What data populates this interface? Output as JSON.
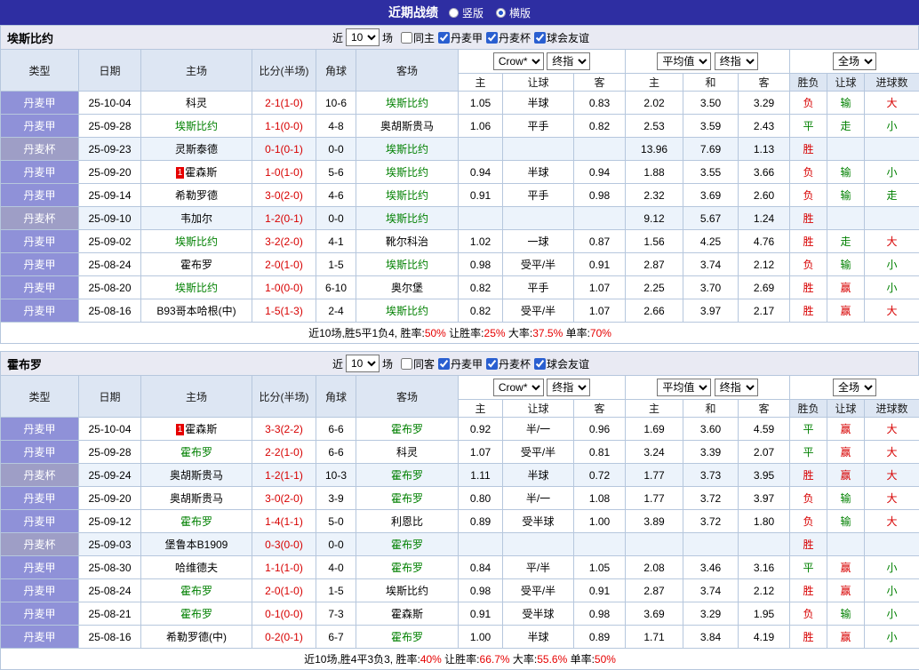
{
  "topbar": {
    "title": "近期战绩",
    "radios": [
      {
        "label": "竖版",
        "checked": false
      },
      {
        "label": "横版",
        "checked": true
      }
    ]
  },
  "colors": {
    "topbar_bg": "#2e2ea2",
    "header_bg": "#dde6f3",
    "type_league_bg": "#8f91d8",
    "type_cup_bg": "#9e9ec6",
    "focal_team_green": "#008000",
    "score_red": "#d70000",
    "summary_value_red": "#e60000"
  },
  "sections": [
    {
      "team": "埃斯比约",
      "filter": {
        "near_label": "近",
        "count": "10",
        "games_label": "场",
        "same_venue": {
          "label": "同主",
          "checked": false
        },
        "leagues": [
          {
            "label": "丹麦甲",
            "checked": true
          },
          {
            "label": "丹麦杯",
            "checked": true
          },
          {
            "label": "球会友谊",
            "checked": true
          }
        ]
      },
      "header": {
        "cols": [
          "类型",
          "日期",
          "主场",
          "比分(半场)",
          "角球",
          "客场"
        ],
        "odds1_selects": [
          "Crow*",
          "终指"
        ],
        "odds1_cols": [
          "主",
          "让球",
          "客"
        ],
        "odds2_selects": [
          "平均值",
          "终指"
        ],
        "odds2_cols": [
          "主",
          "和",
          "客"
        ],
        "result_select": "全场",
        "result_cols": [
          "胜负",
          "让球",
          "进球数"
        ]
      },
      "rows": [
        {
          "type": "丹麦甲",
          "cup": false,
          "date": "25-10-04",
          "home": "科灵",
          "home_focal": false,
          "home_badge": "",
          "score": "2-1(1-0)",
          "corner": "10-6",
          "away": "埃斯比约",
          "away_focal": true,
          "away_badge": "",
          "crow": [
            "1.05",
            "半球",
            "0.83"
          ],
          "avg": [
            "2.02",
            "3.50",
            "3.29"
          ],
          "results": [
            [
              "负",
              "red"
            ],
            [
              "输",
              "green"
            ],
            [
              "大",
              "red"
            ]
          ]
        },
        {
          "type": "丹麦甲",
          "cup": false,
          "date": "25-09-28",
          "home": "埃斯比约",
          "home_focal": true,
          "home_badge": "",
          "score": "1-1(0-0)",
          "corner": "4-8",
          "away": "奥胡斯贵马",
          "away_focal": false,
          "away_badge": "",
          "crow": [
            "1.06",
            "平手",
            "0.82"
          ],
          "avg": [
            "2.53",
            "3.59",
            "2.43"
          ],
          "results": [
            [
              "平",
              "green"
            ],
            [
              "走",
              "green"
            ],
            [
              "小",
              "green"
            ]
          ]
        },
        {
          "type": "丹麦杯",
          "cup": true,
          "date": "25-09-23",
          "home": "灵斯泰德",
          "home_focal": false,
          "home_badge": "",
          "score": "0-1(0-1)",
          "corner": "0-0",
          "away": "埃斯比约",
          "away_focal": true,
          "away_badge": "",
          "crow": [
            "",
            "",
            ""
          ],
          "avg": [
            "13.96",
            "7.69",
            "1.13"
          ],
          "results": [
            [
              "胜",
              "red"
            ],
            [
              "",
              ""
            ],
            [
              "",
              ""
            ]
          ]
        },
        {
          "type": "丹麦甲",
          "cup": false,
          "date": "25-09-20",
          "home": "霍森斯",
          "home_focal": false,
          "home_badge": "1",
          "score": "1-0(1-0)",
          "corner": "5-6",
          "away": "埃斯比约",
          "away_focal": true,
          "away_badge": "",
          "crow": [
            "0.94",
            "半球",
            "0.94"
          ],
          "avg": [
            "1.88",
            "3.55",
            "3.66"
          ],
          "results": [
            [
              "负",
              "red"
            ],
            [
              "输",
              "green"
            ],
            [
              "小",
              "green"
            ]
          ]
        },
        {
          "type": "丹麦甲",
          "cup": false,
          "date": "25-09-14",
          "home": "希勒罗德",
          "home_focal": false,
          "home_badge": "",
          "score": "3-0(2-0)",
          "corner": "4-6",
          "away": "埃斯比约",
          "away_focal": true,
          "away_badge": "",
          "crow": [
            "0.91",
            "平手",
            "0.98"
          ],
          "avg": [
            "2.32",
            "3.69",
            "2.60"
          ],
          "results": [
            [
              "负",
              "red"
            ],
            [
              "输",
              "green"
            ],
            [
              "走",
              "green"
            ]
          ]
        },
        {
          "type": "丹麦杯",
          "cup": true,
          "date": "25-09-10",
          "home": "韦加尔",
          "home_focal": false,
          "home_badge": "",
          "score": "1-2(0-1)",
          "corner": "0-0",
          "away": "埃斯比约",
          "away_focal": true,
          "away_badge": "",
          "crow": [
            "",
            "",
            ""
          ],
          "avg": [
            "9.12",
            "5.67",
            "1.24"
          ],
          "results": [
            [
              "胜",
              "red"
            ],
            [
              "",
              ""
            ],
            [
              "",
              ""
            ]
          ]
        },
        {
          "type": "丹麦甲",
          "cup": false,
          "date": "25-09-02",
          "home": "埃斯比约",
          "home_focal": true,
          "home_badge": "",
          "score": "3-2(2-0)",
          "corner": "4-1",
          "away": "靴尔科治",
          "away_focal": false,
          "away_badge": "",
          "crow": [
            "1.02",
            "一球",
            "0.87"
          ],
          "avg": [
            "1.56",
            "4.25",
            "4.76"
          ],
          "results": [
            [
              "胜",
              "red"
            ],
            [
              "走",
              "green"
            ],
            [
              "大",
              "red"
            ]
          ]
        },
        {
          "type": "丹麦甲",
          "cup": false,
          "date": "25-08-24",
          "home": "霍布罗",
          "home_focal": false,
          "home_badge": "",
          "score": "2-0(1-0)",
          "corner": "1-5",
          "away": "埃斯比约",
          "away_focal": true,
          "away_badge": "",
          "crow": [
            "0.98",
            "受平/半",
            "0.91"
          ],
          "avg": [
            "2.87",
            "3.74",
            "2.12"
          ],
          "results": [
            [
              "负",
              "red"
            ],
            [
              "输",
              "green"
            ],
            [
              "小",
              "green"
            ]
          ]
        },
        {
          "type": "丹麦甲",
          "cup": false,
          "date": "25-08-20",
          "home": "埃斯比约",
          "home_focal": true,
          "home_badge": "",
          "score": "1-0(0-0)",
          "corner": "6-10",
          "away": "奥尔堡",
          "away_focal": false,
          "away_badge": "",
          "crow": [
            "0.82",
            "平手",
            "1.07"
          ],
          "avg": [
            "2.25",
            "3.70",
            "2.69"
          ],
          "results": [
            [
              "胜",
              "red"
            ],
            [
              "赢",
              "red"
            ],
            [
              "小",
              "green"
            ]
          ]
        },
        {
          "type": "丹麦甲",
          "cup": false,
          "date": "25-08-16",
          "home": "B93哥本哈根(中)",
          "home_focal": false,
          "home_badge": "",
          "score": "1-5(1-3)",
          "corner": "2-4",
          "away": "埃斯比约",
          "away_focal": true,
          "away_badge": "",
          "crow": [
            "0.82",
            "受平/半",
            "1.07"
          ],
          "avg": [
            "2.66",
            "3.97",
            "2.17"
          ],
          "results": [
            [
              "胜",
              "red"
            ],
            [
              "赢",
              "red"
            ],
            [
              "大",
              "red"
            ]
          ]
        }
      ],
      "summary": [
        [
          "近10场,胜5平1负4, 胜率:",
          "k"
        ],
        [
          "50%",
          "v"
        ],
        [
          " 让胜率:",
          "k"
        ],
        [
          "25%",
          "v"
        ],
        [
          " 大率:",
          "k"
        ],
        [
          "37.5%",
          "v"
        ],
        [
          " 单率:",
          "k"
        ],
        [
          "70%",
          "v"
        ]
      ]
    },
    {
      "team": "霍布罗",
      "filter": {
        "near_label": "近",
        "count": "10",
        "games_label": "场",
        "same_venue": {
          "label": "同客",
          "checked": false
        },
        "leagues": [
          {
            "label": "丹麦甲",
            "checked": true
          },
          {
            "label": "丹麦杯",
            "checked": true
          },
          {
            "label": "球会友谊",
            "checked": true
          }
        ]
      },
      "header": {
        "cols": [
          "类型",
          "日期",
          "主场",
          "比分(半场)",
          "角球",
          "客场"
        ],
        "odds1_selects": [
          "Crow*",
          "终指"
        ],
        "odds1_cols": [
          "主",
          "让球",
          "客"
        ],
        "odds2_selects": [
          "平均值",
          "终指"
        ],
        "odds2_cols": [
          "主",
          "和",
          "客"
        ],
        "result_select": "全场",
        "result_cols": [
          "胜负",
          "让球",
          "进球数"
        ]
      },
      "rows": [
        {
          "type": "丹麦甲",
          "cup": false,
          "date": "25-10-04",
          "home": "霍森斯",
          "home_focal": false,
          "home_badge": "1",
          "score": "3-3(2-2)",
          "corner": "6-6",
          "away": "霍布罗",
          "away_focal": true,
          "away_badge": "",
          "crow": [
            "0.92",
            "半/一",
            "0.96"
          ],
          "avg": [
            "1.69",
            "3.60",
            "4.59"
          ],
          "results": [
            [
              "平",
              "green"
            ],
            [
              "赢",
              "red"
            ],
            [
              "大",
              "red"
            ]
          ]
        },
        {
          "type": "丹麦甲",
          "cup": false,
          "date": "25-09-28",
          "home": "霍布罗",
          "home_focal": true,
          "home_badge": "",
          "score": "2-2(1-0)",
          "corner": "6-6",
          "away": "科灵",
          "away_focal": false,
          "away_badge": "",
          "crow": [
            "1.07",
            "受平/半",
            "0.81"
          ],
          "avg": [
            "3.24",
            "3.39",
            "2.07"
          ],
          "results": [
            [
              "平",
              "green"
            ],
            [
              "赢",
              "red"
            ],
            [
              "大",
              "red"
            ]
          ]
        },
        {
          "type": "丹麦杯",
          "cup": true,
          "date": "25-09-24",
          "home": "奥胡斯贵马",
          "home_focal": false,
          "home_badge": "",
          "score": "1-2(1-1)",
          "corner": "10-3",
          "away": "霍布罗",
          "away_focal": true,
          "away_badge": "",
          "crow": [
            "1.11",
            "半球",
            "0.72"
          ],
          "avg": [
            "1.77",
            "3.73",
            "3.95"
          ],
          "results": [
            [
              "胜",
              "red"
            ],
            [
              "赢",
              "red"
            ],
            [
              "大",
              "red"
            ]
          ]
        },
        {
          "type": "丹麦甲",
          "cup": false,
          "date": "25-09-20",
          "home": "奥胡斯贵马",
          "home_focal": false,
          "home_badge": "",
          "score": "3-0(2-0)",
          "corner": "3-9",
          "away": "霍布罗",
          "away_focal": true,
          "away_badge": "",
          "crow": [
            "0.80",
            "半/一",
            "1.08"
          ],
          "avg": [
            "1.77",
            "3.72",
            "3.97"
          ],
          "results": [
            [
              "负",
              "red"
            ],
            [
              "输",
              "green"
            ],
            [
              "大",
              "red"
            ]
          ]
        },
        {
          "type": "丹麦甲",
          "cup": false,
          "date": "25-09-12",
          "home": "霍布罗",
          "home_focal": true,
          "home_badge": "",
          "score": "1-4(1-1)",
          "corner": "5-0",
          "away": "利恩比",
          "away_focal": false,
          "away_badge": "",
          "crow": [
            "0.89",
            "受半球",
            "1.00"
          ],
          "avg": [
            "3.89",
            "3.72",
            "1.80"
          ],
          "results": [
            [
              "负",
              "red"
            ],
            [
              "输",
              "green"
            ],
            [
              "大",
              "red"
            ]
          ]
        },
        {
          "type": "丹麦杯",
          "cup": true,
          "date": "25-09-03",
          "home": "堡鲁本B1909",
          "home_focal": false,
          "home_badge": "",
          "score": "0-3(0-0)",
          "corner": "0-0",
          "away": "霍布罗",
          "away_focal": true,
          "away_badge": "",
          "crow": [
            "",
            "",
            ""
          ],
          "avg": [
            "",
            "",
            ""
          ],
          "results": [
            [
              "胜",
              "red"
            ],
            [
              "",
              ""
            ],
            [
              "",
              ""
            ]
          ]
        },
        {
          "type": "丹麦甲",
          "cup": false,
          "date": "25-08-30",
          "home": "哈维德夫",
          "home_focal": false,
          "home_badge": "",
          "score": "1-1(1-0)",
          "corner": "4-0",
          "away": "霍布罗",
          "away_focal": true,
          "away_badge": "",
          "crow": [
            "0.84",
            "平/半",
            "1.05"
          ],
          "avg": [
            "2.08",
            "3.46",
            "3.16"
          ],
          "results": [
            [
              "平",
              "green"
            ],
            [
              "赢",
              "red"
            ],
            [
              "小",
              "green"
            ]
          ]
        },
        {
          "type": "丹麦甲",
          "cup": false,
          "date": "25-08-24",
          "home": "霍布罗",
          "home_focal": true,
          "home_badge": "",
          "score": "2-0(1-0)",
          "corner": "1-5",
          "away": "埃斯比约",
          "away_focal": false,
          "away_badge": "",
          "crow": [
            "0.98",
            "受平/半",
            "0.91"
          ],
          "avg": [
            "2.87",
            "3.74",
            "2.12"
          ],
          "results": [
            [
              "胜",
              "red"
            ],
            [
              "赢",
              "red"
            ],
            [
              "小",
              "green"
            ]
          ]
        },
        {
          "type": "丹麦甲",
          "cup": false,
          "date": "25-08-21",
          "home": "霍布罗",
          "home_focal": true,
          "home_badge": "",
          "score": "0-1(0-0)",
          "corner": "7-3",
          "away": "霍森斯",
          "away_focal": false,
          "away_badge": "",
          "crow": [
            "0.91",
            "受半球",
            "0.98"
          ],
          "avg": [
            "3.69",
            "3.29",
            "1.95"
          ],
          "results": [
            [
              "负",
              "red"
            ],
            [
              "输",
              "green"
            ],
            [
              "小",
              "green"
            ]
          ]
        },
        {
          "type": "丹麦甲",
          "cup": false,
          "date": "25-08-16",
          "home": "希勒罗德(中)",
          "home_focal": false,
          "home_badge": "",
          "score": "0-2(0-1)",
          "corner": "6-7",
          "away": "霍布罗",
          "away_focal": true,
          "away_badge": "",
          "crow": [
            "1.00",
            "半球",
            "0.89"
          ],
          "avg": [
            "1.71",
            "3.84",
            "4.19"
          ],
          "results": [
            [
              "胜",
              "red"
            ],
            [
              "赢",
              "red"
            ],
            [
              "小",
              "green"
            ]
          ]
        }
      ],
      "summary": [
        [
          "近10场,胜4平3负3, 胜率:",
          "k"
        ],
        [
          "40%",
          "v"
        ],
        [
          " 让胜率:",
          "k"
        ],
        [
          "66.7%",
          "v"
        ],
        [
          " 大率:",
          "k"
        ],
        [
          "55.6%",
          "v"
        ],
        [
          " 单率:",
          "k"
        ],
        [
          "50%",
          "v"
        ]
      ]
    }
  ]
}
